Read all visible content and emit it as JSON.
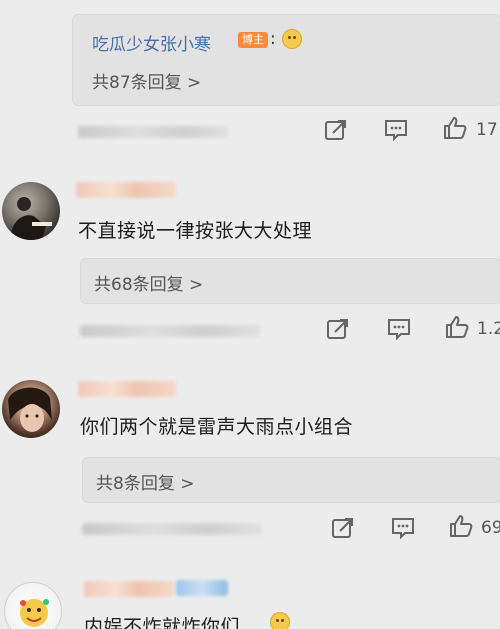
{
  "comments": [
    {
      "reply": {
        "user": "吃瓜少女张小寒",
        "badge": "博主",
        "colon": ":",
        "count_label": "共87条回复 >"
      },
      "likes": "17"
    },
    {
      "text": "不直接说一律按张大大处理",
      "reply": {
        "count_label": "共68条回复 >"
      },
      "likes": "1.2"
    },
    {
      "text": "你们两个就是雷声大雨点小组合",
      "reply": {
        "count_label": "共8条回复 >"
      },
      "likes": "69"
    },
    {
      "text": "内娱不炸就炸你们"
    }
  ],
  "icons": {
    "share": "share-icon",
    "comment": "comment-icon",
    "like": "thumbs-up-icon",
    "emoji": "doge-emoji-icon"
  },
  "colors": {
    "background": "#ececec",
    "reply_box": "#e2e2e2",
    "reply_user": "#4a6ea5",
    "badge": "#ff8a3a",
    "text": "#1d1d1d",
    "muted": "#555555"
  }
}
